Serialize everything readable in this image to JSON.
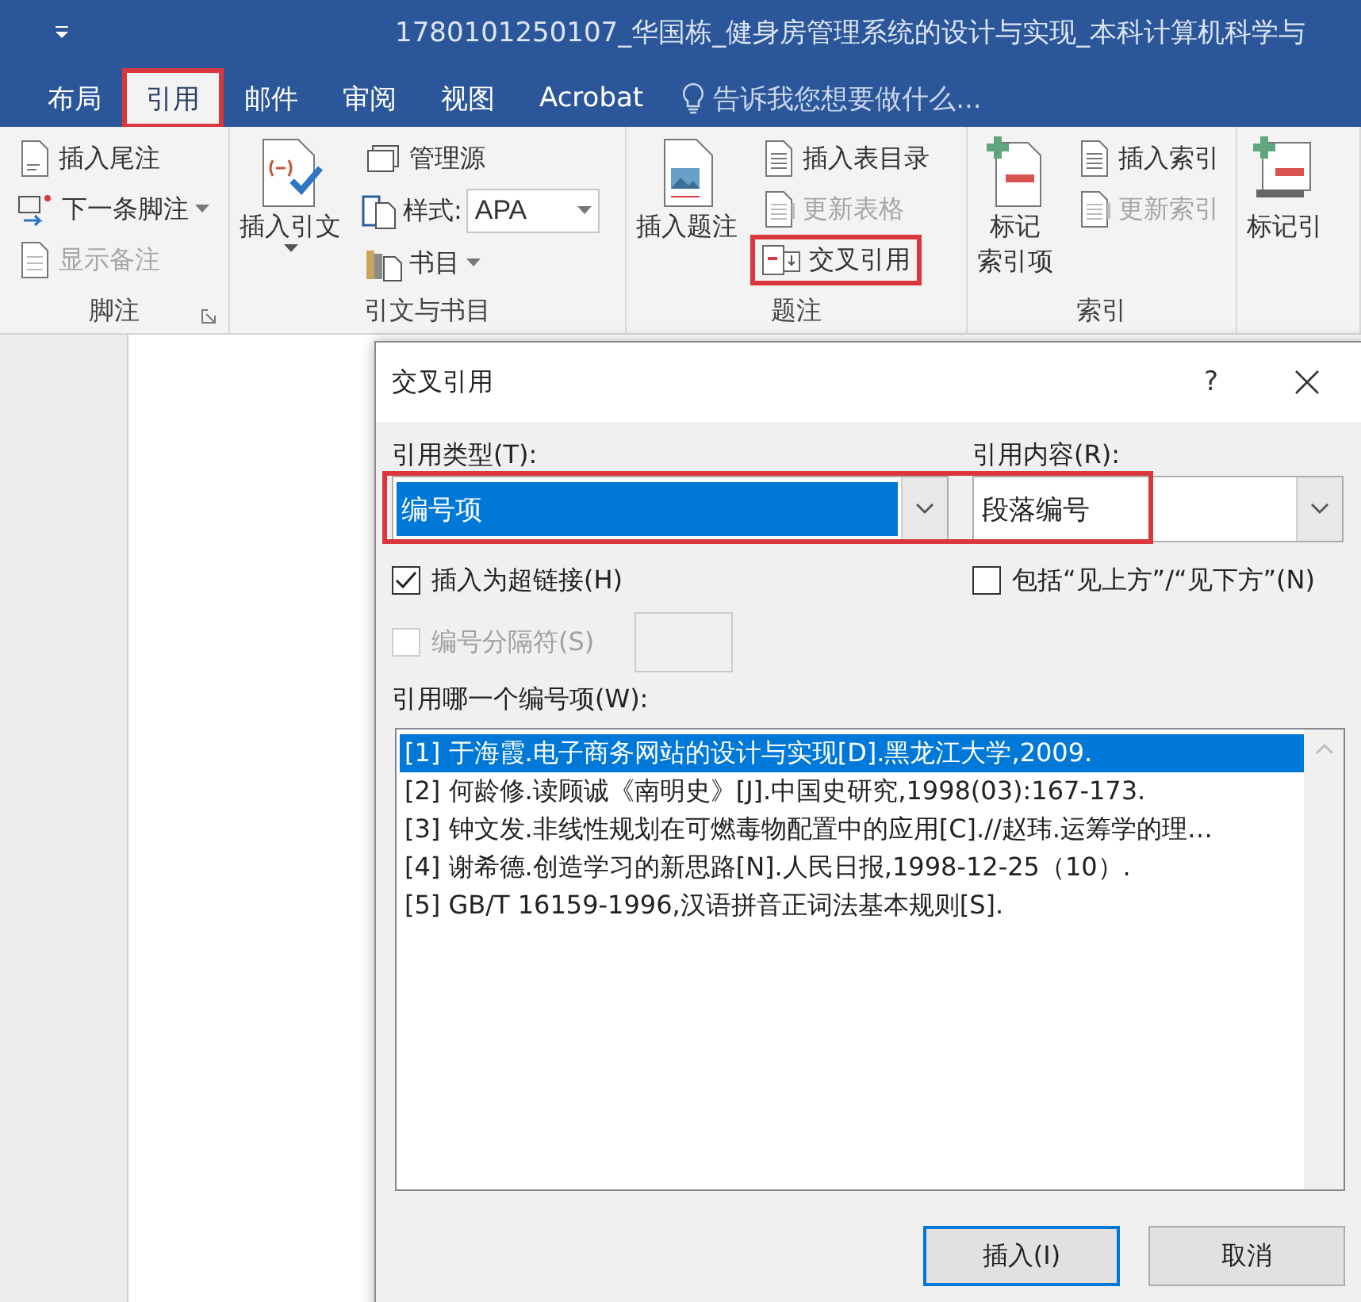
{
  "title_bar": {
    "title": "1780101250107_华国栋_健身房管理系统的设计与实现_本科计算机科学与"
  },
  "tabs": [
    {
      "label": "布局",
      "selected": false,
      "highlighted": false
    },
    {
      "label": "引用",
      "selected": true,
      "highlighted": true
    },
    {
      "label": "邮件",
      "selected": false,
      "highlighted": false
    },
    {
      "label": "审阅",
      "selected": false,
      "highlighted": false
    },
    {
      "label": "视图",
      "selected": false,
      "highlighted": false
    },
    {
      "label": "Acrobat",
      "selected": false,
      "highlighted": false
    }
  ],
  "tell_me": {
    "placeholder": "告诉我您想要做什么..."
  },
  "ribbon": {
    "groups": [
      {
        "label": "脚注",
        "launcher": true,
        "items": [
          {
            "kind": "small",
            "label": "插入尾注",
            "disabled": false
          },
          {
            "kind": "small",
            "label": "下一条脚注",
            "disabled": false,
            "dropdown": true
          },
          {
            "kind": "small",
            "label": "显示备注",
            "disabled": true
          }
        ]
      },
      {
        "label": "引文与书目",
        "items": [
          {
            "kind": "large",
            "lines": [
              "插入引文"
            ],
            "dropdown": true
          },
          {
            "kind": "small",
            "label": "管理源",
            "disabled": false
          },
          {
            "kind": "select",
            "label": "样式:",
            "value": "APA"
          },
          {
            "kind": "small",
            "label": "书目",
            "disabled": false,
            "dropdown": true
          }
        ]
      },
      {
        "label": "题注",
        "items": [
          {
            "kind": "large",
            "lines": [
              "插入题注"
            ]
          },
          {
            "kind": "small",
            "label": "插入表目录",
            "disabled": false
          },
          {
            "kind": "small",
            "label": "更新表格",
            "disabled": true
          },
          {
            "kind": "small",
            "label": "交叉引用",
            "disabled": false,
            "highlighted": true
          }
        ]
      },
      {
        "label": "索引",
        "items": [
          {
            "kind": "large",
            "lines": [
              "标记",
              "索引项"
            ]
          },
          {
            "kind": "small",
            "label": "插入索引",
            "disabled": false
          },
          {
            "kind": "small",
            "label": "更新索引",
            "disabled": true
          }
        ]
      },
      {
        "items": [
          {
            "kind": "large",
            "lines": [
              "标记引"
            ]
          }
        ]
      }
    ]
  },
  "dialog": {
    "title": "交叉引用",
    "help": "?",
    "selectors_highlighted": true,
    "selectors": [
      {
        "label": "引用类型(T):",
        "value": "编号项",
        "focused": true
      },
      {
        "label": "引用内容(R):",
        "value": "段落编号",
        "focused": false
      }
    ],
    "options": [
      {
        "label": "插入为超链接(H)",
        "checked": true,
        "disabled": false
      },
      {
        "label": "包括“见上方”/“见下方”(N)",
        "checked": false,
        "disabled": false
      },
      {
        "label": "编号分隔符(S)",
        "checked": false,
        "disabled": true
      }
    ],
    "list": {
      "label": "引用哪一个编号项(W):",
      "items": [
        {
          "text": "[1] 于海霞.电子商务网站的设计与实现[D].黑龙江大学,2009.",
          "selected": true
        },
        {
          "text": "[2] 何龄修.读顾诚《南明史》[J].中国史研究,1998(03):167-173.",
          "selected": false
        },
        {
          "text": "[3] 钟文发.非线性规划在可燃毒物配置中的应用[C].//赵玮.运筹学的理…",
          "selected": false
        },
        {
          "text": "[4] 谢希德.创造学习的新思路[N].人民日报,1998-12-25（10）.",
          "selected": false
        },
        {
          "text": "[5] GB/T 16159-1996,汉语拼音正词法基本规则[S].",
          "selected": false
        }
      ]
    },
    "buttons": [
      {
        "label": "插入(I)",
        "default": true
      },
      {
        "label": "取消",
        "default": false
      }
    ]
  }
}
